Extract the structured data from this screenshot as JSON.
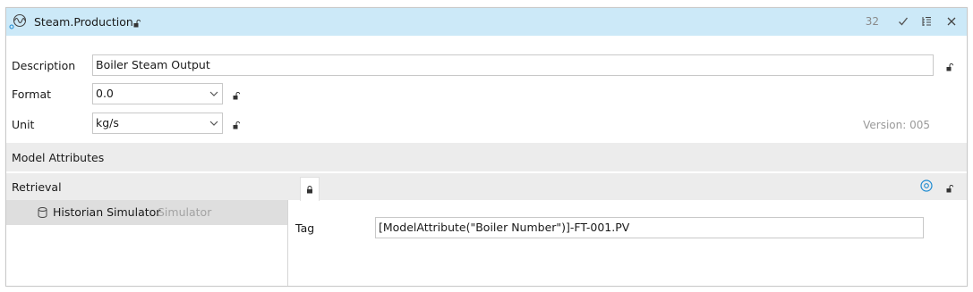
{
  "title_bar": {
    "title": "Steam.Production",
    "count": "32"
  },
  "form": {
    "description_label": "Description",
    "description_value": "Boiler Steam Output",
    "format_label": "Format",
    "format_value": "0.0",
    "unit_label": "Unit",
    "unit_value": "kg/s",
    "version": "Version: 005"
  },
  "sections": {
    "model_attributes": "Model Attributes",
    "retrieval": "Retrieval"
  },
  "retrieval_list": [
    {
      "name": "Historian Simulator",
      "type": "Simulator"
    }
  ],
  "detail": {
    "tag_label": "Tag",
    "tag_value": "[ModelAttribute(\"Boiler Number\")]-FT-001.PV"
  },
  "icons": {
    "title": "sine-wave-icon",
    "lock": "lock-open-icon",
    "check": "checkmark-icon",
    "tree": "tree-list-icon",
    "close": "close-icon",
    "database": "database-icon",
    "info": "info-circle-icon"
  },
  "colors": {
    "title_bar": "#cce9f8",
    "section_bar": "#ececec",
    "selected_row": "#dedede",
    "info_icon": "#1e8bd1"
  }
}
